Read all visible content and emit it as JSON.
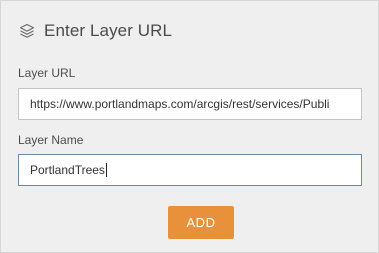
{
  "header": {
    "icon": "layers-icon",
    "title": "Enter Layer URL"
  },
  "layer_url": {
    "label": "Layer URL",
    "value": "https://www.portlandmaps.com/arcgis/rest/services/Publi"
  },
  "layer_name": {
    "label": "Layer Name",
    "value": "PortlandTrees"
  },
  "add_button": {
    "label": "ADD"
  },
  "colors": {
    "panel_background": "#efefef",
    "button_accent": "#e8913a",
    "focused_border": "#6f88a6"
  }
}
